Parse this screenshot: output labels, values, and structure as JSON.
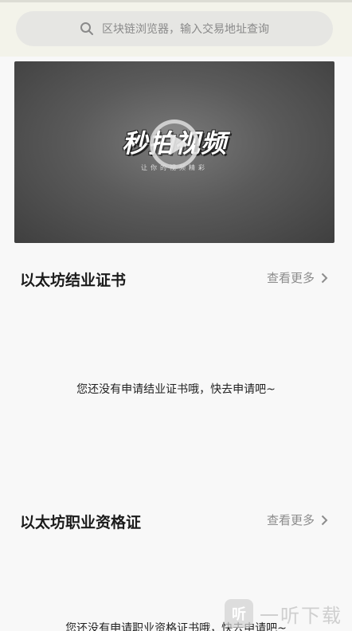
{
  "search": {
    "placeholder": "区块链浏览器，输入交易地址查询"
  },
  "video": {
    "logo_text": "秒拍视频",
    "sub_text": "让你的视频精彩"
  },
  "certificate": {
    "title": "以太坊结业证书",
    "more_label": "查看更多",
    "empty_text": "您还没有申请结业证书哦，快去申请吧~"
  },
  "qualification": {
    "title": "以太坊职业资格证",
    "more_label": "查看更多",
    "empty_text": "您还没有申请职业资格证书哦，快去申请吧~"
  },
  "watermark": {
    "icon": "听",
    "text": "一听下载"
  }
}
